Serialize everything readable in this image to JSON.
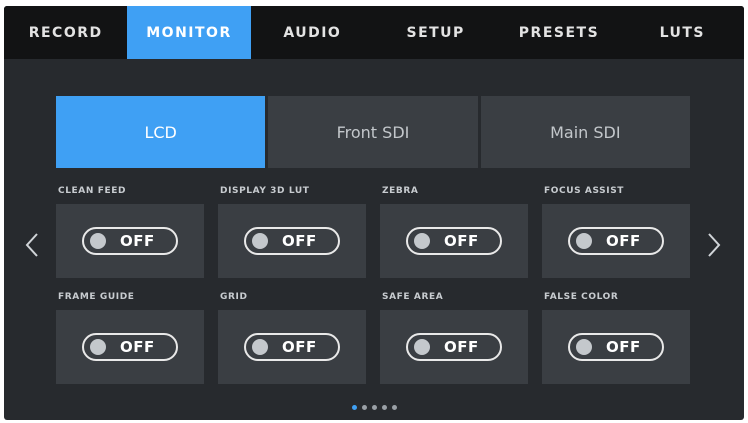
{
  "tabs": [
    {
      "label": "RECORD",
      "active": false
    },
    {
      "label": "MONITOR",
      "active": true
    },
    {
      "label": "AUDIO",
      "active": false
    },
    {
      "label": "SETUP",
      "active": false
    },
    {
      "label": "PRESETS",
      "active": false
    },
    {
      "label": "LUTS",
      "active": false
    }
  ],
  "outputs": [
    {
      "label": "LCD",
      "active": true
    },
    {
      "label": "Front SDI",
      "active": false
    },
    {
      "label": "Main SDI",
      "active": false
    }
  ],
  "settings": [
    {
      "label": "CLEAN FEED",
      "value": "OFF"
    },
    {
      "label": "DISPLAY 3D LUT",
      "value": "OFF"
    },
    {
      "label": "ZEBRA",
      "value": "OFF"
    },
    {
      "label": "FOCUS ASSIST",
      "value": "OFF"
    },
    {
      "label": "FRAME GUIDE",
      "value": "OFF"
    },
    {
      "label": "GRID",
      "value": "OFF"
    },
    {
      "label": "SAFE AREA",
      "value": "OFF"
    },
    {
      "label": "FALSE COLOR",
      "value": "OFF"
    }
  ],
  "navigation": {
    "prev_icon": "chevron-left-icon",
    "next_icon": "chevron-right-icon"
  },
  "pagination": {
    "page_count": 5,
    "current_page": 1
  },
  "colors": {
    "accent": "#3fa0f4",
    "tab_bar": "#121314",
    "panel": "#3a3e43",
    "background": "#272a2e"
  }
}
